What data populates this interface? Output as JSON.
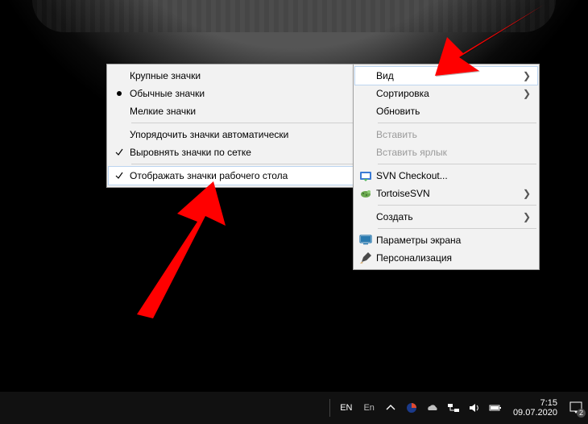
{
  "menu": {
    "view": "Вид",
    "sort": "Сортировка",
    "refresh": "Обновить",
    "paste": "Вставить",
    "paste_shortcut": "Вставить ярлык",
    "svn_checkout": "SVN Checkout...",
    "tortoise": "TortoiseSVN",
    "create": "Создать",
    "display_settings": "Параметры экрана",
    "personalize": "Персонализация"
  },
  "submenu": {
    "large_icons": "Крупные значки",
    "medium_icons": "Обычные значки",
    "small_icons": "Мелкие значки",
    "auto_arrange": "Упорядочить значки автоматически",
    "align_grid": "Выровнять значки по сетке",
    "show_desktop_icons": "Отображать значки рабочего стола"
  },
  "tray": {
    "lang1": "EN",
    "lang2": "En",
    "time": "7:15",
    "date": "09.07.2020",
    "notif_count": "2"
  }
}
